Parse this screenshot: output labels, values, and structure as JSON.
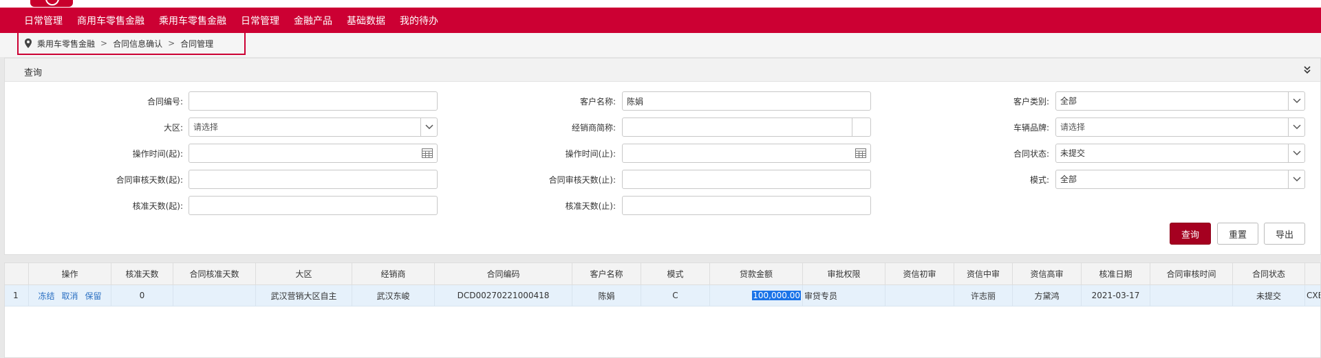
{
  "nav": [
    "日常管理",
    "商用车零售金融",
    "乘用车零售金融",
    "日常管理",
    "金融产品",
    "基础数据",
    "我的待办"
  ],
  "breadcrumb": {
    "items": [
      "乘用车零售金融",
      "合同信息确认",
      "合同管理"
    ],
    "separator": ">"
  },
  "query": {
    "title": "查询",
    "labels": {
      "contract_no": "合同编号:",
      "customer_name": "客户名称:",
      "customer_type": "客户类别:",
      "region": "大区:",
      "dealer_short": "经销商简称:",
      "brand": "车辆品牌:",
      "op_time_start": "操作时间(起):",
      "op_time_end": "操作时间(止):",
      "contract_status": "合同状态:",
      "review_days_start": "合同审核天数(起):",
      "review_days_end": "合同审核天数(止):",
      "mode": "模式:",
      "approve_days_start": "核准天数(起):",
      "approve_days_end": "核准天数(止):"
    },
    "values": {
      "contract_no": "",
      "customer_name": "陈娟",
      "customer_type": "全部",
      "region": "请选择",
      "dealer_short": "",
      "brand": "请选择",
      "op_time_start": "",
      "op_time_end": "",
      "contract_status": "未提交",
      "review_days_start": "",
      "review_days_end": "",
      "mode": "全部",
      "approve_days_start": "",
      "approve_days_end": ""
    },
    "buttons": {
      "search": "查询",
      "reset": "重置",
      "export": "导出"
    }
  },
  "table": {
    "headers": [
      "操作",
      "核准天数",
      "合同核准天数",
      "大区",
      "经销商",
      "合同编码",
      "客户名称",
      "模式",
      "贷款金额",
      "审批权限",
      "资信初审",
      "资信中审",
      "资信高审",
      "核准日期",
      "合同审核时间",
      "合同状态"
    ],
    "actions": [
      "冻结",
      "取消",
      "保留"
    ],
    "rows": [
      {
        "index": "1",
        "approve_days": "0",
        "contract_approve_days": "",
        "region": "武汉营销大区自主",
        "dealer": "武汉东峻",
        "contract_code": "DCD00270221000418",
        "customer": "陈娟",
        "mode": "C",
        "loan_amount": "100,000.00",
        "approval_auth": "审贷专员",
        "credit_first": "",
        "credit_mid": "许志丽",
        "credit_high": "方黛鸿",
        "approve_date": "2021-03-17",
        "review_time": "",
        "status": "未提交",
        "overflow": "CXB"
      }
    ]
  },
  "colors": {
    "brand": "#cc0033",
    "primary_button": "#a50020",
    "link": "#2a6fc2",
    "row_highlight": "#e6f1fb"
  }
}
